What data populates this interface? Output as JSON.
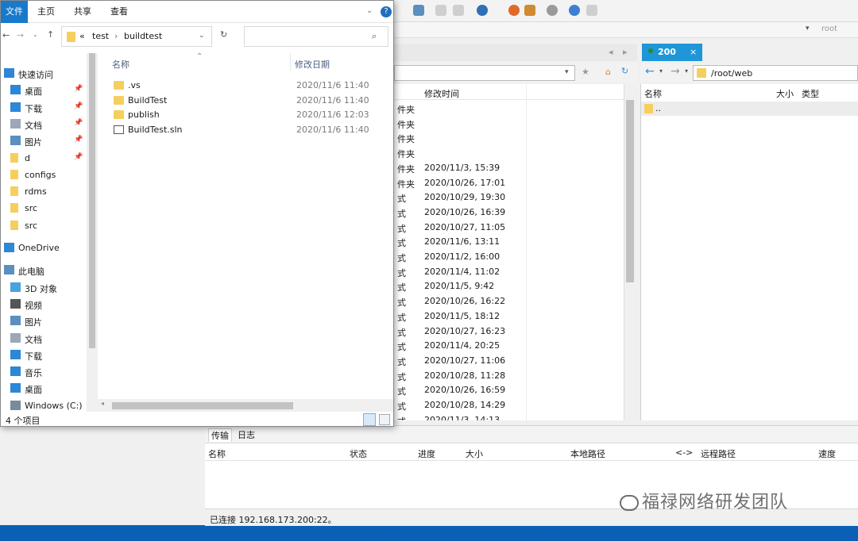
{
  "explorer": {
    "ribbon_tabs": [
      "文件",
      "主页",
      "共享",
      "查看"
    ],
    "address": {
      "chevrons": "«",
      "crumbs": [
        "test",
        "buildtest"
      ]
    },
    "search_placeholder": "",
    "nav": {
      "quick_access": "快速访问",
      "quick_items": [
        {
          "label": "桌面",
          "pinned": true,
          "icon": "desktop-icon"
        },
        {
          "label": "下载",
          "pinned": true,
          "icon": "download-icon"
        },
        {
          "label": "文档",
          "pinned": true,
          "icon": "document-icon"
        },
        {
          "label": "图片",
          "pinned": true,
          "icon": "picture-icon"
        },
        {
          "label": "d",
          "pinned": true,
          "icon": "folder-icon"
        },
        {
          "label": "configs",
          "pinned": false,
          "icon": "folder-icon"
        },
        {
          "label": "rdms",
          "pinned": false,
          "icon": "folder-icon"
        },
        {
          "label": "src",
          "pinned": false,
          "icon": "folder-icon"
        },
        {
          "label": "src",
          "pinned": false,
          "icon": "folder-icon"
        }
      ],
      "onedrive": "OneDrive",
      "this_pc": "此电脑",
      "pc_items": [
        {
          "label": "3D 对象",
          "icon": "3d-objects-icon"
        },
        {
          "label": "视频",
          "icon": "video-icon"
        },
        {
          "label": "图片",
          "icon": "picture-icon"
        },
        {
          "label": "文档",
          "icon": "document-icon"
        },
        {
          "label": "下载",
          "icon": "download-icon"
        },
        {
          "label": "音乐",
          "icon": "music-icon"
        },
        {
          "label": "桌面",
          "icon": "desktop-icon"
        },
        {
          "label": "Windows (C:)",
          "icon": "drive-icon"
        }
      ]
    },
    "columns": {
      "name": "名称",
      "modified": "修改日期"
    },
    "files": [
      {
        "name": ".vs",
        "modified": "2020/11/6 11:40",
        "icon": "folder-icon"
      },
      {
        "name": "BuildTest",
        "modified": "2020/11/6 11:40",
        "icon": "folder-icon"
      },
      {
        "name": "publish",
        "modified": "2020/11/6 12:03",
        "icon": "folder-icon"
      },
      {
        "name": "BuildTest.sln",
        "modified": "2020/11/6 11:40",
        "icon": "solution-file-icon"
      }
    ],
    "status": "4 个项目"
  },
  "ftp": {
    "root_label": "root",
    "left_panel": {
      "col_modified": "修改时间",
      "rows": [
        {
          "type": "件夹",
          "time": ""
        },
        {
          "type": "件夹",
          "time": ""
        },
        {
          "type": "件夹",
          "time": ""
        },
        {
          "type": "件夹",
          "time": ""
        },
        {
          "type": "件夹",
          "time": "2020/11/3, 15:39"
        },
        {
          "type": "件夹",
          "time": "2020/10/26, 17:01"
        },
        {
          "type": "式",
          "time": "2020/10/29, 19:30"
        },
        {
          "type": "式",
          "time": "2020/10/26, 16:39"
        },
        {
          "type": "式",
          "time": "2020/10/27, 11:05"
        },
        {
          "type": "式",
          "time": "2020/11/6, 13:11"
        },
        {
          "type": "式",
          "time": "2020/11/2, 16:00"
        },
        {
          "type": "式",
          "time": "2020/11/4, 11:02"
        },
        {
          "type": "式",
          "time": "2020/11/5, 9:42"
        },
        {
          "type": "式",
          "time": "2020/10/26, 16:22"
        },
        {
          "type": "式",
          "time": "2020/11/5, 18:12"
        },
        {
          "type": "式",
          "time": "2020/10/27, 16:23"
        },
        {
          "type": "式",
          "time": "2020/11/4, 20:25"
        },
        {
          "type": "式",
          "time": "2020/10/27, 11:06"
        },
        {
          "type": "式",
          "time": "2020/10/28, 11:28"
        },
        {
          "type": "式",
          "time": "2020/10/26, 16:59"
        },
        {
          "type": "式",
          "time": "2020/10/28, 14:29"
        },
        {
          "type": "式",
          "time": "2020/11/3, 14:13"
        }
      ]
    },
    "right_panel": {
      "tab_label": "200",
      "path": "/root/web",
      "col_name": "名称",
      "col_size": "大小",
      "col_type": "类型",
      "parent_row": ".."
    },
    "transfer": {
      "tabs": [
        "传输",
        "日志"
      ],
      "columns": [
        "名称",
        "状态",
        "进度",
        "大小",
        "本地路径",
        "<->",
        "远程路径",
        "速度"
      ],
      "status": "已连接 192.168.173.200:22。"
    },
    "watermark": "福禄网络研发团队"
  },
  "colors": {
    "accent": "#1979ca",
    "folder": "#f5cf5e",
    "session_tab": "#1e96d8"
  }
}
